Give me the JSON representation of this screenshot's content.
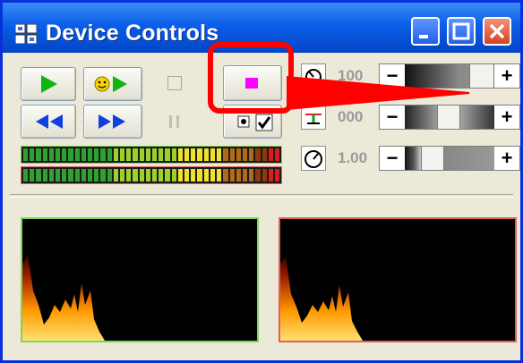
{
  "window": {
    "title": "Device Controls"
  },
  "icons": {
    "app": "device-controls-icon",
    "minimize": "minimize-icon",
    "maximize": "maximize-icon",
    "close": "close-icon",
    "play": "play-icon",
    "smile_play": "smile-play-icon",
    "rewind": "rewind-icon",
    "fast_forward": "fast-forward-icon",
    "stop": "stop-icon",
    "pause": "pause-icon",
    "record": "record-icon",
    "check": "check-icon",
    "volume": "volume-knob-icon",
    "balance": "balance-icon",
    "speed": "speed-gauge-icon"
  },
  "sliders": [
    {
      "name": "volume",
      "value_label": "100",
      "minus": "−",
      "plus": "+"
    },
    {
      "name": "balance",
      "value_label": "000",
      "minus": "−",
      "plus": "+"
    },
    {
      "name": "speed",
      "value_label": "1.00",
      "minus": "−",
      "plus": "+"
    }
  ],
  "colors": {
    "title_bar": "#0a5ee8",
    "highlight": "#ff0000",
    "stop_square": "#ff00ff",
    "play_green": "#11b511",
    "seek_blue": "#1040e0",
    "left_meter_border": "#7fd45a",
    "right_meter_border": "#e06060"
  }
}
